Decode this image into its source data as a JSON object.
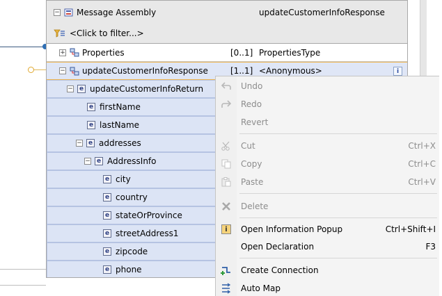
{
  "header": {
    "title": "Message Assembly",
    "right_label": "updateCustomerInfoResponse",
    "filter_label": "<Click to filter...>"
  },
  "tree": {
    "properties": {
      "name": "Properties",
      "cardinality": "[0..1]",
      "type": "PropertiesType"
    },
    "response": {
      "name": "updateCustomerInfoResponse",
      "cardinality": "[1..1]",
      "type": "<Anonymous>"
    },
    "elements": [
      {
        "name": "updateCustomerInfoReturn",
        "toggle": "⊟"
      },
      {
        "name": "firstName",
        "toggle": ""
      },
      {
        "name": "lastName",
        "toggle": ""
      },
      {
        "name": "addresses",
        "toggle": "⊟"
      },
      {
        "name": "AddressInfo",
        "toggle": "⊟"
      },
      {
        "name": "city",
        "toggle": ""
      },
      {
        "name": "country",
        "toggle": ""
      },
      {
        "name": "stateOrProvince",
        "toggle": ""
      },
      {
        "name": "streetAddress1",
        "toggle": ""
      },
      {
        "name": "zipcode",
        "toggle": ""
      },
      {
        "name": "phone",
        "toggle": ""
      }
    ]
  },
  "context_menu": {
    "items": [
      {
        "label": "Undo",
        "shortcut": "",
        "icon": "undo-icon",
        "enabled": false
      },
      {
        "label": "Redo",
        "shortcut": "",
        "icon": "redo-icon",
        "enabled": false
      },
      {
        "label": "Revert",
        "shortcut": "",
        "icon": "",
        "enabled": false
      },
      {
        "label": "Cut",
        "shortcut": "Ctrl+X",
        "icon": "cut-icon",
        "enabled": false
      },
      {
        "label": "Copy",
        "shortcut": "Ctrl+C",
        "icon": "copy-icon",
        "enabled": false
      },
      {
        "label": "Paste",
        "shortcut": "Ctrl+V",
        "icon": "paste-icon",
        "enabled": false
      },
      {
        "label": "Delete",
        "shortcut": "",
        "icon": "delete-icon",
        "enabled": false
      },
      {
        "label": "Open Information Popup",
        "shortcut": "Ctrl+Shift+I",
        "icon": "info-icon",
        "enabled": true
      },
      {
        "label": "Open Declaration",
        "shortcut": "F3",
        "icon": "",
        "enabled": true
      },
      {
        "label": "Create Connection",
        "shortcut": "",
        "icon": "create-connection-icon",
        "enabled": true
      },
      {
        "label": "Auto Map",
        "shortcut": "",
        "icon": "auto-map-icon",
        "enabled": true
      }
    ]
  },
  "colors": {
    "element_row_bg": "#dce4f5",
    "selected_border": "#f0b44c",
    "element_icon": "#2d3f83"
  }
}
